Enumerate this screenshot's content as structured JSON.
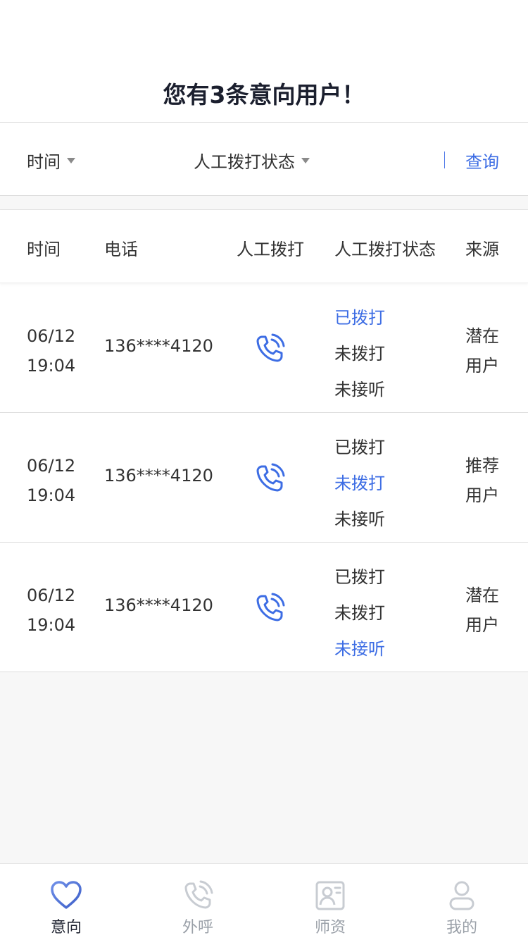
{
  "header": {
    "title": "您有3条意向用户！"
  },
  "filters": {
    "time_label": "时间",
    "status_label": "人工拨打状态",
    "query_label": "查询"
  },
  "table": {
    "columns": [
      "时间",
      "电话",
      "人工拨打",
      "人工拨打状态",
      "来源"
    ],
    "rows": [
      {
        "date": "06/12",
        "time": "19:04",
        "phone": "136****4120",
        "status_options": [
          "已拨打",
          "未拨打",
          "未接听"
        ],
        "active_status": "已拨打",
        "source_line1": "潜在",
        "source_line2": "用户"
      },
      {
        "date": "06/12",
        "time": "19:04",
        "phone": "136****4120",
        "status_options": [
          "已拨打",
          "未拨打",
          "未接听"
        ],
        "active_status": "未拨打",
        "source_line1": "推荐",
        "source_line2": "用户"
      },
      {
        "date": "06/12",
        "time": "19:04",
        "phone": "136****4120",
        "status_options": [
          "已拨打",
          "未拨打",
          "未接听"
        ],
        "active_status": "未接听",
        "source_line1": "潜在",
        "source_line2": "用户"
      }
    ],
    "call_icon": "phone-call-icon"
  },
  "tabbar": {
    "items": [
      {
        "label": "意向",
        "icon": "heart-icon",
        "active": true
      },
      {
        "label": "外呼",
        "icon": "phone-call-icon",
        "active": false
      },
      {
        "label": "师资",
        "icon": "teacher-card-icon",
        "active": false
      },
      {
        "label": "我的",
        "icon": "user-icon",
        "active": false
      }
    ]
  },
  "colors": {
    "accent": "#3d6de4",
    "text": "#333333",
    "muted": "#9aa0a8",
    "background": "#f7f7f7"
  }
}
